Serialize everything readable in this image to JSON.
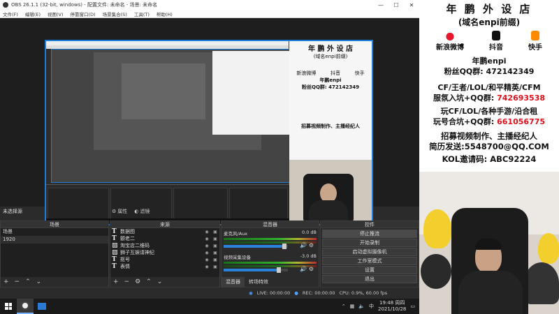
{
  "window": {
    "title": "OBS 26.1.1 (32-bit, windows) - 配置文件: 未命名 - 场景: 未命名",
    "min": "—",
    "max": "☐",
    "close": "✕"
  },
  "menu": [
    "文件(F)",
    "编辑(E)",
    "视图(V)",
    "停靠窗口(D)",
    "场景集合(S)",
    "工具(T)",
    "帮助(H)"
  ],
  "preview_overlay": {
    "title": "年 鹏 外 设 店",
    "subtitle": "(域名enpi前缀)",
    "socials": [
      "新浪微博",
      "抖音",
      "快手"
    ],
    "name": "年鹏enpi",
    "fans": "粉丝QQ群: 472142349",
    "recruit": "招募视频制作、主播经纪人"
  },
  "status_left": "未选择源",
  "props": {
    "properties": "属性",
    "filters": "滤镜"
  },
  "docks": {
    "scenes": {
      "title": "场景",
      "items": [
        "场景",
        "1920"
      ]
    },
    "sources": {
      "title": "来源",
      "items": [
        {
          "icon": "T",
          "name": "数据图"
        },
        {
          "icon": "T",
          "name": "颤老二"
        },
        {
          "icon": "img",
          "name": "淘宝店二维码"
        },
        {
          "icon": "img",
          "name": "狮子互娱请神纪"
        },
        {
          "icon": "T",
          "name": "抠号"
        },
        {
          "icon": "T",
          "name": "表情"
        }
      ]
    },
    "mixer": {
      "title": "混音器",
      "channels": [
        {
          "name": "麦克风/Aux",
          "db": "0.0 dB",
          "level": 0.95
        },
        {
          "name": "视频采集设备",
          "db": "-3.0 dB",
          "level": 0.85
        }
      ],
      "tabs": [
        "混音器",
        "转场特效"
      ]
    },
    "controls": {
      "title": "控件",
      "buttons": [
        "停止推流",
        "开始录制",
        "启动虚拟摄像机",
        "工作室模式",
        "设置",
        "退出"
      ]
    }
  },
  "statusbar": {
    "live": "LIVE: 00:00:00",
    "rec": "REC: 00:00:00",
    "cpu": "CPU: 0.9%, 60.00 fps"
  },
  "right_overlay": {
    "title": "年 鹏 外 设 店",
    "subtitle": "(域名enpi前缀)",
    "socials": [
      "新浪微博",
      "抖音",
      "快手"
    ],
    "name": "年鹏enpi",
    "fans": "粉丝QQ群: 472142349",
    "line1": "CF/王者/LOL/和平精英/CFM",
    "line2_prefix": "服氛入坑+QQ群: ",
    "line2_num": "742693538",
    "line3": "玩CF/LOL/各种手游/沿合租",
    "line4_prefix": "玩号合坑+QQ群: ",
    "line4_num": "661056775",
    "line5": "招募视频制作、主播经纪人",
    "line6": "简历发送:5548700@QQ.COM",
    "line7": "KOL邀请码: ABC92224"
  },
  "taskbar": {
    "time": "19:48 周四",
    "date": "2021/10/28"
  }
}
